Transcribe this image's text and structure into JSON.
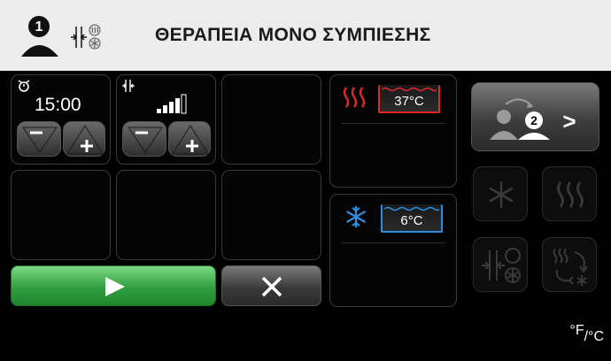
{
  "header": {
    "title": "ΘΕΡΑΠΕΙΑ ΜΟΝΟ ΣΥΜΠΙΕΣΗΣ",
    "user_number": "1"
  },
  "timer": {
    "value": "15:00"
  },
  "intensity": {
    "level": 4,
    "max": 5
  },
  "hot_panel": {
    "temperature": "37°C"
  },
  "cold_panel": {
    "temperature": "6°C"
  },
  "switch_user": {
    "user_number": "2",
    "arrow": ">"
  },
  "unit_toggle": {
    "f": "°F",
    "c": "/°C"
  },
  "colors": {
    "accent_green": "#3fbf5a",
    "hot_red": "#e0282a",
    "cold_blue": "#2d8fe0",
    "header_bg": "#ececec"
  }
}
